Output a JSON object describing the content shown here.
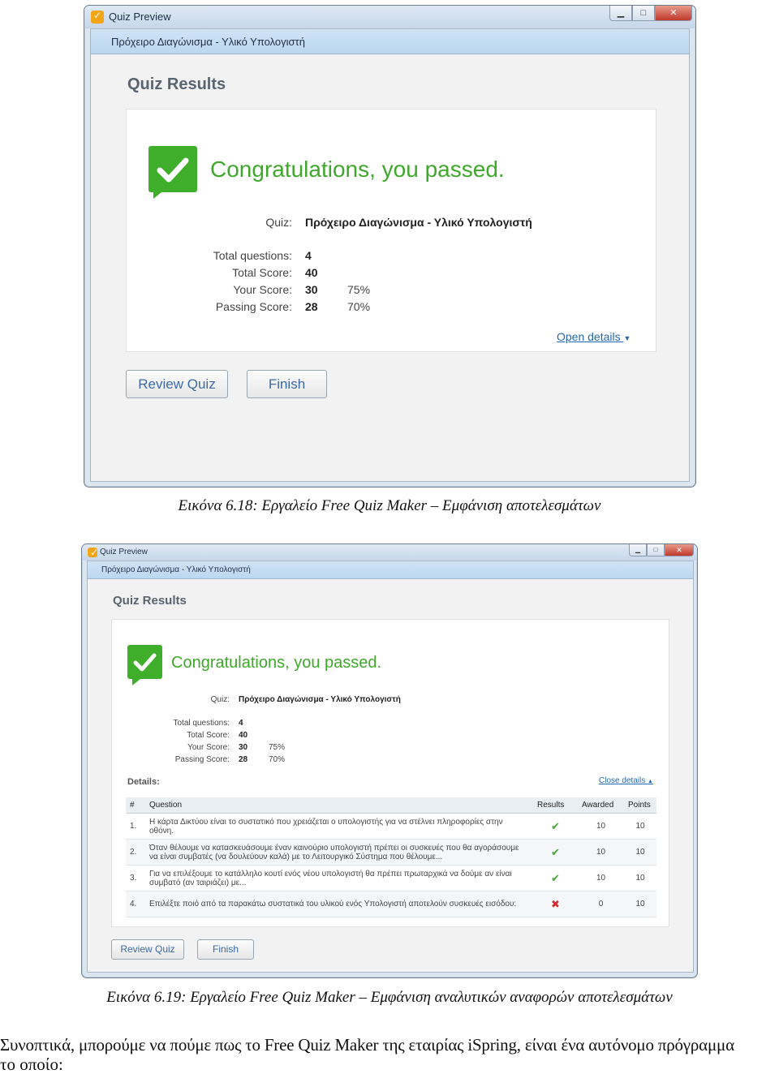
{
  "window1": {
    "title": "Quiz Preview",
    "subtitle": "Πρόχειρο Διαγώνισμα - Υλικό Υπολογιστή",
    "heading": "Quiz Results",
    "congrats": "Congratulations, you passed.",
    "quiz_label": "Quiz:",
    "quiz_name": "Πρόχειρο Διαγώνισμα - Υλικό Υπολογιστή",
    "stats": [
      {
        "label": "Total questions:",
        "value": "4",
        "pct": ""
      },
      {
        "label": "Total Score:",
        "value": "40",
        "pct": ""
      },
      {
        "label": "Your Score:",
        "value": "30",
        "pct": "75%"
      },
      {
        "label": "Passing Score:",
        "value": "28",
        "pct": "70%"
      }
    ],
    "details_link": "Open details",
    "review_button": "Review Quiz",
    "finish_button": "Finish"
  },
  "caption1": "Εικόνα 6.18: Εργαλείο Free Quiz Maker – Εμφάνιση αποτελεσμάτων",
  "window2": {
    "title": "Quiz Preview",
    "subtitle": "Πρόχειρο Διαγώνισμα - Υλικό Υπολογιστή",
    "heading": "Quiz Results",
    "congrats": "Congratulations, you passed.",
    "quiz_label": "Quiz:",
    "quiz_name": "Πρόχειρο Διαγώνισμα - Υλικό Υπολογιστή",
    "stats": [
      {
        "label": "Total questions:",
        "value": "4",
        "pct": ""
      },
      {
        "label": "Total Score:",
        "value": "40",
        "pct": ""
      },
      {
        "label": "Your Score:",
        "value": "30",
        "pct": "75%"
      },
      {
        "label": "Passing Score:",
        "value": "28",
        "pct": "70%"
      }
    ],
    "details_label": "Details:",
    "details_link": "Close details",
    "table": {
      "headers": [
        "#",
        "Question",
        "Results",
        "Awarded",
        "Points"
      ],
      "rows": [
        {
          "num": "1.",
          "question": "Η κάρτα Δικτύου είναι το συστατικό που χρειάζεται ο υπολογιστής για να στέλνει πληροφορίες στην οθόνη.",
          "result": "correct",
          "awarded": "10",
          "points": "10"
        },
        {
          "num": "2.",
          "question": "Όταν θέλουμε να κατασκευάσουμε έναν καινούριο υπολογιστή πρέπει οι συσκευές που θα αγοράσουμε να είναι συμβατές (να δουλεύουν καλά) με το Λειτουργικό Σύστημα που θέλουμε...",
          "result": "correct",
          "awarded": "10",
          "points": "10"
        },
        {
          "num": "3.",
          "question": "Για να επιλέξουμε το κατάλληλο κουτί ενός νέου υπολογιστή θα πρέπει πρωταρχικά να δούμε αν είναι συμβατό (αν ταιριάζει) με...",
          "result": "correct",
          "awarded": "10",
          "points": "10"
        },
        {
          "num": "4.",
          "question": "Επιλέξτε ποιό από τα παρακάτω συστατικά του υλικού ενός Υπολογιστή αποτελούν συσκευές εισόδου:",
          "result": "incorrect",
          "awarded": "0",
          "points": "10"
        }
      ]
    },
    "review_button": "Review Quiz",
    "finish_button": "Finish"
  },
  "caption2": "Εικόνα 6.19: Εργαλείο Free Quiz Maker – Εμφάνιση αναλυτικών αναφορών αποτελεσμάτων",
  "paragraph_line1": "Συνοπτικά, μπορούμε να πούμε πως το Free Quiz Maker της εταιρίας iSpring, είναι ένα αυτόνομο πρόγραμμα",
  "paragraph_line2": "το οποίο:",
  "icons": {
    "pass_badge": "check-badge-icon",
    "correct": "check-icon",
    "incorrect": "cross-icon"
  },
  "colors": {
    "success": "#3fae2a",
    "link": "#2468b0",
    "error": "#d22c2c"
  }
}
